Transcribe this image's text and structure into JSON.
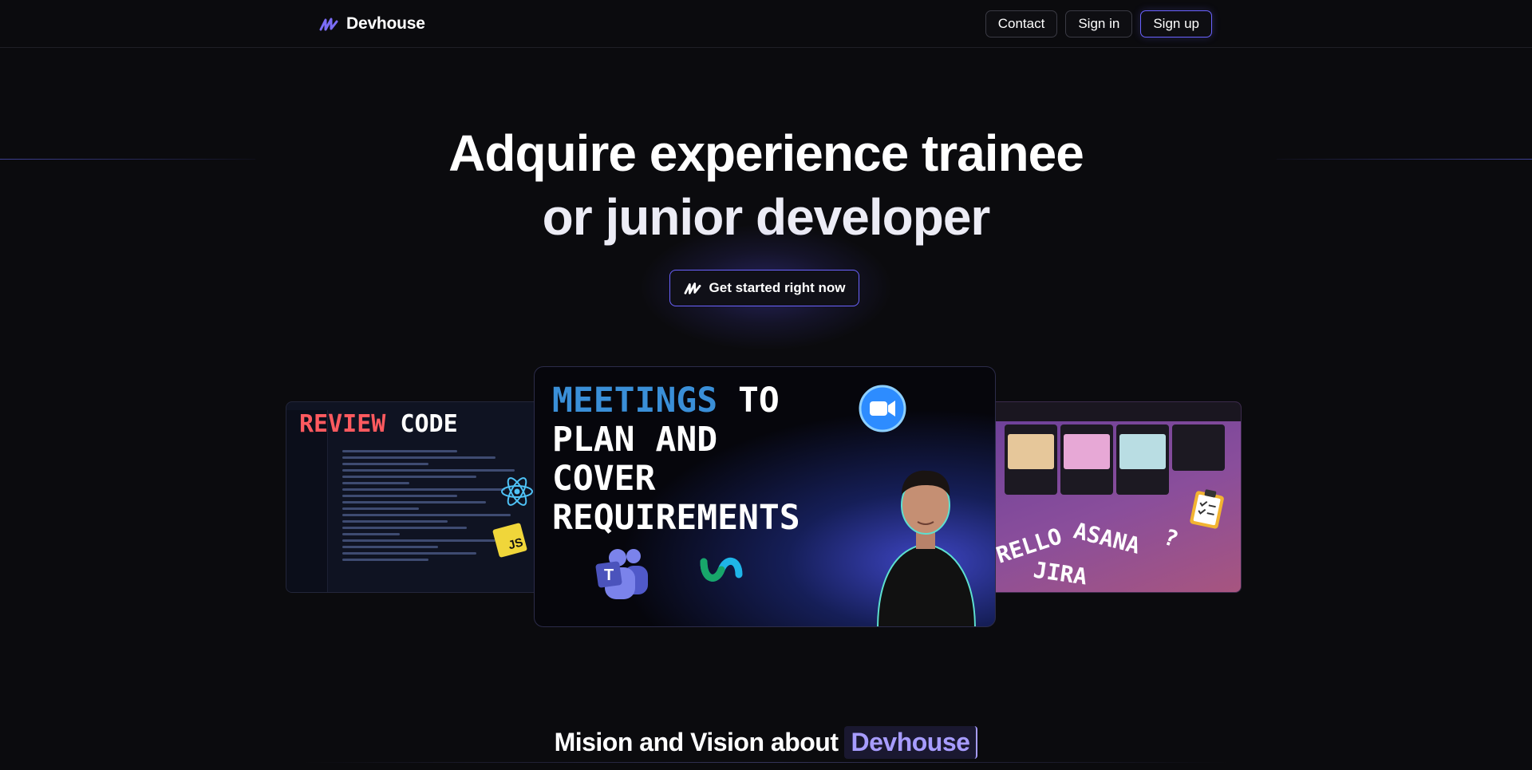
{
  "header": {
    "brand_name": "Devhouse",
    "contact_label": "Contact",
    "signin_label": "Sign in",
    "signup_label": "Sign up"
  },
  "hero": {
    "title_line1": "Adquire experience trainee",
    "title_line2": "or junior developer",
    "cta_label": "Get started right now"
  },
  "cards": {
    "left": {
      "title_highlight": "REVIEW",
      "title_rest": "CODE",
      "badge": "JS"
    },
    "center": {
      "title_highlight": "MEETINGS",
      "title_rest_1": "TO",
      "title_line2": "PLAN AND",
      "title_line3": "COVER",
      "title_line4": "REQUIREMENTS",
      "teams_letter": "T"
    },
    "right": {
      "word_1": "TRELLO",
      "word_2": "ASANA",
      "word_3": "JIRA",
      "word_4": "?"
    }
  },
  "mission": {
    "title": "Mision and Vision about",
    "highlight": "Devhouse"
  },
  "colors": {
    "accent": "#6b63ff",
    "highlight_red": "#ff5a5f",
    "highlight_blue": "#3a8fd8",
    "mission_accent": "#a79cff"
  },
  "icons": [
    "devhouse-logo-icon",
    "react-icon",
    "zoom-icon",
    "teams-icon",
    "webex-icon",
    "clipboard-icon"
  ]
}
